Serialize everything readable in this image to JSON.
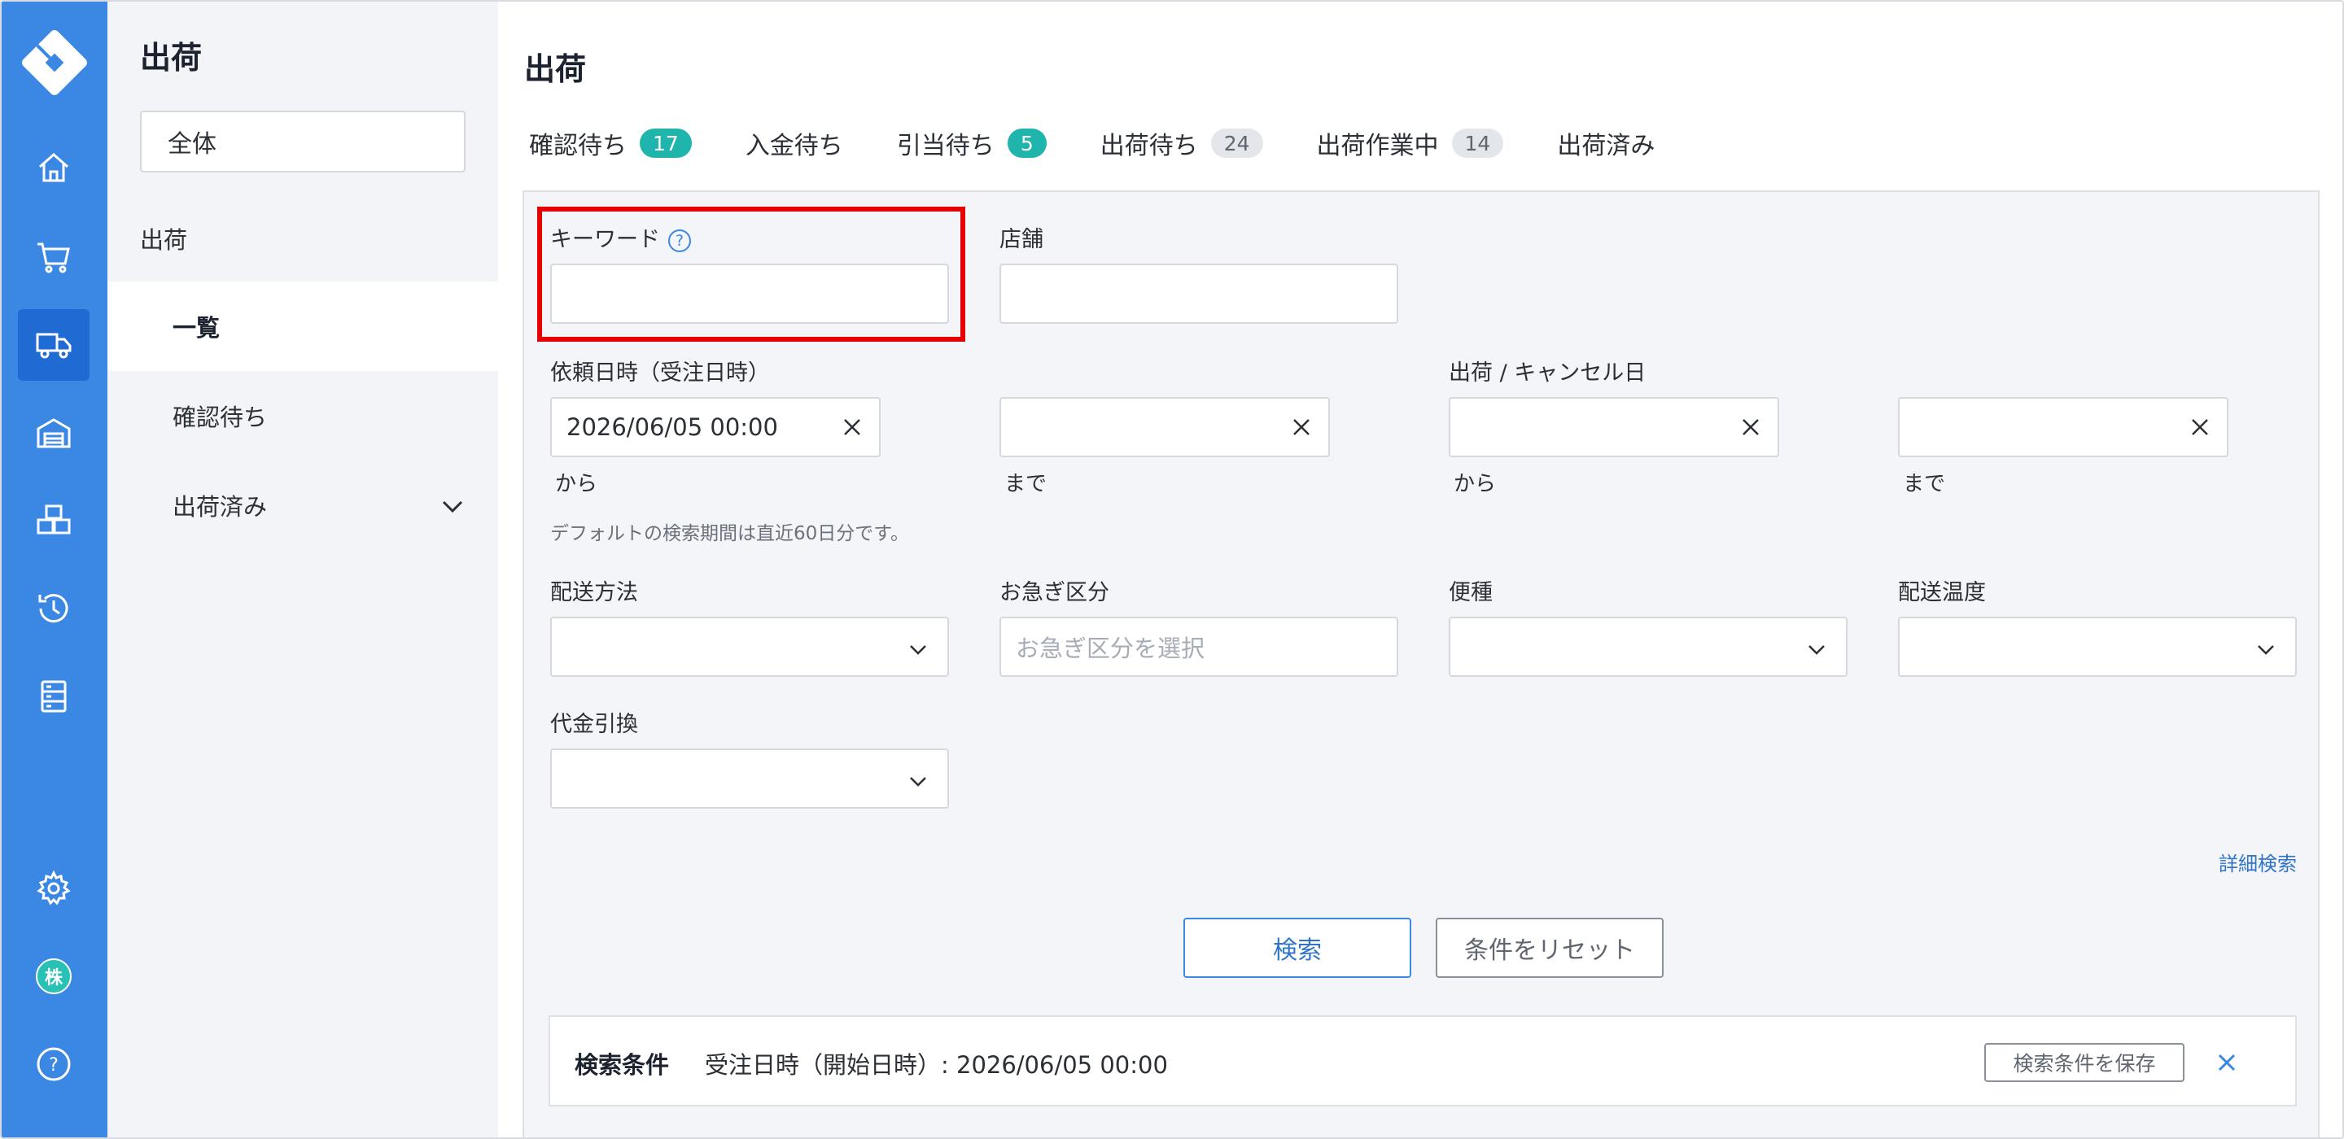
{
  "sidebar": {
    "title": "出荷",
    "scope_value": "全体",
    "section": "出荷",
    "items": [
      {
        "label": "一覧"
      },
      {
        "label": "確認待ち"
      },
      {
        "label": "出荷済み"
      }
    ],
    "rail_icons": [
      "logo-icon",
      "home-icon",
      "cart-icon",
      "truck-icon",
      "warehouse-icon",
      "boxes-icon",
      "history-icon",
      "server-icon",
      "gear-icon",
      "avatar-icon",
      "help-icon"
    ],
    "avatar_text": "株",
    "help_text": "?"
  },
  "main": {
    "title": "出荷",
    "tabs": [
      {
        "label": "確認待ち",
        "badge": "17"
      },
      {
        "label": "入金待ち"
      },
      {
        "label": "引当待ち",
        "badge": "5"
      },
      {
        "label": "出荷待ち",
        "badge": "24"
      },
      {
        "label": "出荷作業中",
        "badge": "14"
      },
      {
        "label": "出荷済み"
      }
    ]
  },
  "filters": {
    "keyword": {
      "label": "キーワード",
      "help": "?",
      "value": ""
    },
    "store": {
      "label": "店舗",
      "value": ""
    },
    "request_date": {
      "label": "依頼日時（受注日時）",
      "from_value": "2026/06/05 00:00",
      "to_value": "",
      "from_label": "から",
      "to_label": "まで"
    },
    "ship_date": {
      "label": "出荷 / キャンセル日",
      "from_value": "",
      "to_value": "",
      "from_label": "から",
      "to_label": "まで"
    },
    "hint": "デフォルトの検索期間は直近60日分です。",
    "delivery_method": {
      "label": "配送方法",
      "value": ""
    },
    "urgency": {
      "label": "お急ぎ区分",
      "placeholder": "お急ぎ区分を選択"
    },
    "flight": {
      "label": "便種",
      "value": ""
    },
    "temperature": {
      "label": "配送温度",
      "value": ""
    },
    "cod": {
      "label": "代金引換",
      "value": ""
    },
    "advanced_link": "詳細検索",
    "search_button": "検索",
    "reset_button": "条件をリセット"
  },
  "conditions": {
    "title": "検索条件",
    "text": "受注日時（開始日時）: 2026/06/05 00:00",
    "save_button": "検索条件を保存",
    "close": "×"
  },
  "colors": {
    "rail": "#3a87e4",
    "rail_active": "#1f6ad3",
    "badge_teal": "#1fb5ad",
    "highlight": "#e60000",
    "link": "#2f74c7"
  }
}
